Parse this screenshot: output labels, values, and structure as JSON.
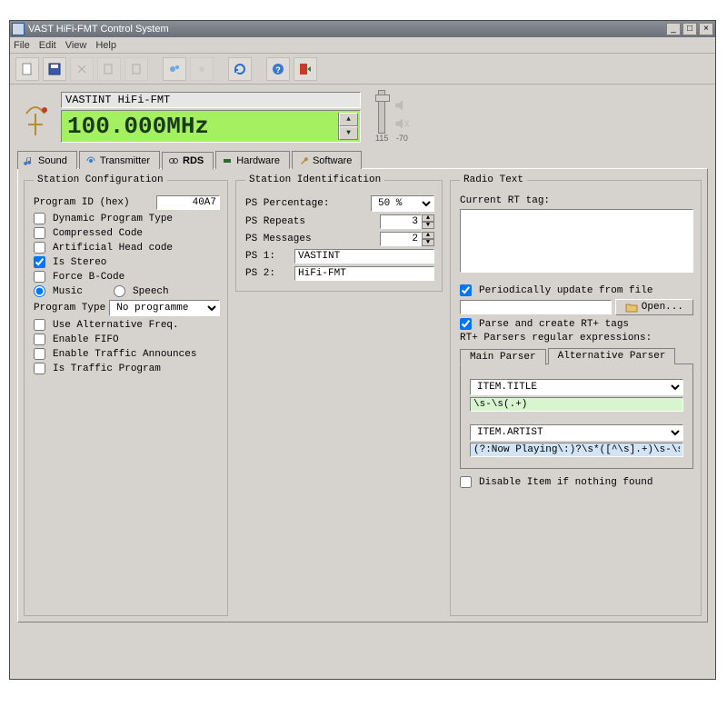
{
  "window": {
    "title": "VAST HiFi-FMT Control System"
  },
  "menu": {
    "file": "File",
    "edit": "Edit",
    "view": "View",
    "help": "Help"
  },
  "freq": {
    "station_line": "VASTINT HiFi-FMT",
    "display": "100.000MHz",
    "vol_left": "115",
    "vol_right": "-70"
  },
  "tabs": {
    "sound": "Sound",
    "transmitter": "Transmitter",
    "rds": "RDS",
    "hardware": "Hardware",
    "software": "Software"
  },
  "station_cfg": {
    "legend": "Station Configuration",
    "program_id_label": "Program ID (hex)",
    "program_id": "40A7",
    "dynamic_pt": "Dynamic Program Type",
    "compressed": "Compressed Code",
    "artificial": "Artificial Head code",
    "is_stereo": "Is Stereo",
    "force_b": "Force B-Code",
    "music": "Music",
    "speech": "Speech",
    "program_type_label": "Program Type",
    "program_type": "No programme",
    "use_alt": "Use Alternative Freq.",
    "enable_fifo": "Enable FIFO",
    "enable_ta": "Enable Traffic Announces",
    "is_tp": "Is Traffic Program"
  },
  "station_id": {
    "legend": "Station Identification",
    "ps_pct_label": "PS Percentage:",
    "ps_pct": "50 %",
    "ps_repeats_label": "PS Repeats",
    "ps_repeats": "3",
    "ps_msgs_label": "PS Messages",
    "ps_msgs": "2",
    "ps1_label": "PS 1:",
    "ps1": "VASTINT",
    "ps2_label": "PS 2:",
    "ps2": "HiFi-FMT"
  },
  "radio_text": {
    "legend": "Radio Text",
    "current_label": "Current RT tag:",
    "current": "",
    "periodic": "Periodically update from file",
    "file_path": "",
    "open": "Open...",
    "parse": "Parse and create RT+ tags",
    "regex_label": "RT+ Parsers regular expressions:",
    "tab_main": "Main Parser",
    "tab_alt": "Alternative Parser",
    "item_title": "ITEM.TITLE",
    "regex_title": "\\s-\\s(.+)",
    "item_artist": "ITEM.ARTIST",
    "regex_artist": "(?:Now Playing\\:)?\\s*([^\\s].+)\\s-\\s",
    "disable": "Disable Item if nothing found"
  }
}
